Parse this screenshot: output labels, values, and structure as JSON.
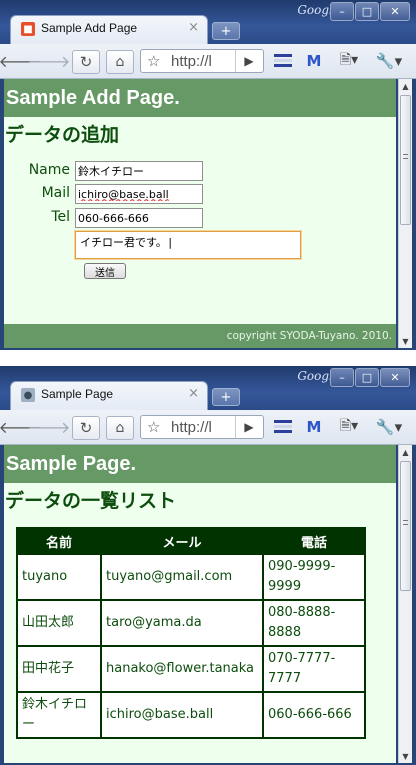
{
  "browser": {
    "brand": "Google",
    "omnibox_text": "http://l",
    "window_controls": [
      "minimize",
      "maximize",
      "close"
    ]
  },
  "add_window": {
    "tab_title": "Sample Add Page",
    "header": "Sample Add Page.",
    "subtitle": "データの追加",
    "form": {
      "name_label": "Name",
      "name_value": "鈴木イチロー",
      "mail_label": "Mail",
      "mail_value": "ichiro@base.ball",
      "tel_label": "Tel",
      "tel_value": "060-666-666",
      "message_value": "イチロー君です。|",
      "submit_label": "送信"
    },
    "footer": "copyright SYODA-Tuyano. 2010."
  },
  "list_window": {
    "tab_title": "Sample Page",
    "header": "Sample Page.",
    "subtitle": "データの一覧リスト",
    "table": {
      "columns": [
        "名前",
        "メール",
        "電話"
      ],
      "rows": [
        [
          "tuyano",
          "tuyano@gmail.com",
          "090-9999-9999"
        ],
        [
          "山田太郎",
          "taro@yama.da",
          "080-8888-8888"
        ],
        [
          "田中花子",
          "hanako@flower.tanaka",
          "070-7777-7777"
        ],
        [
          "鈴木イチロー",
          "ichiro@base.ball",
          "060-666-666"
        ]
      ]
    }
  },
  "colors": {
    "header_bg": "#669966",
    "page_bg": "#eeffee",
    "heading_text": "#0d4d0d",
    "table_header_bg": "#003300"
  }
}
